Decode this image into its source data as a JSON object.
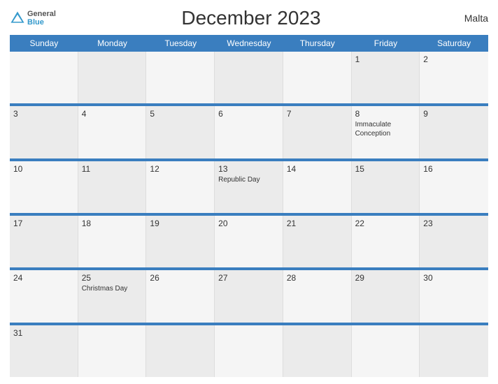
{
  "header": {
    "title": "December 2023",
    "country": "Malta",
    "logo": {
      "general": "General",
      "blue": "Blue"
    }
  },
  "calendar": {
    "days_of_week": [
      "Sunday",
      "Monday",
      "Tuesday",
      "Wednesday",
      "Thursday",
      "Friday",
      "Saturday"
    ],
    "rows": [
      [
        {
          "day": "",
          "holiday": ""
        },
        {
          "day": "",
          "holiday": ""
        },
        {
          "day": "",
          "holiday": ""
        },
        {
          "day": "",
          "holiday": ""
        },
        {
          "day": "",
          "holiday": ""
        },
        {
          "day": "1",
          "holiday": ""
        },
        {
          "day": "2",
          "holiday": ""
        }
      ],
      [
        {
          "day": "3",
          "holiday": ""
        },
        {
          "day": "4",
          "holiday": ""
        },
        {
          "day": "5",
          "holiday": ""
        },
        {
          "day": "6",
          "holiday": ""
        },
        {
          "day": "7",
          "holiday": ""
        },
        {
          "day": "8",
          "holiday": "Immaculate\nConception"
        },
        {
          "day": "9",
          "holiday": ""
        }
      ],
      [
        {
          "day": "10",
          "holiday": ""
        },
        {
          "day": "11",
          "holiday": ""
        },
        {
          "day": "12",
          "holiday": ""
        },
        {
          "day": "13",
          "holiday": "Republic Day"
        },
        {
          "day": "14",
          "holiday": ""
        },
        {
          "day": "15",
          "holiday": ""
        },
        {
          "day": "16",
          "holiday": ""
        }
      ],
      [
        {
          "day": "17",
          "holiday": ""
        },
        {
          "day": "18",
          "holiday": ""
        },
        {
          "day": "19",
          "holiday": ""
        },
        {
          "day": "20",
          "holiday": ""
        },
        {
          "day": "21",
          "holiday": ""
        },
        {
          "day": "22",
          "holiday": ""
        },
        {
          "day": "23",
          "holiday": ""
        }
      ],
      [
        {
          "day": "24",
          "holiday": ""
        },
        {
          "day": "25",
          "holiday": "Christmas Day"
        },
        {
          "day": "26",
          "holiday": ""
        },
        {
          "day": "27",
          "holiday": ""
        },
        {
          "day": "28",
          "holiday": ""
        },
        {
          "day": "29",
          "holiday": ""
        },
        {
          "day": "30",
          "holiday": ""
        }
      ],
      [
        {
          "day": "31",
          "holiday": ""
        },
        {
          "day": "",
          "holiday": ""
        },
        {
          "day": "",
          "holiday": ""
        },
        {
          "day": "",
          "holiday": ""
        },
        {
          "day": "",
          "holiday": ""
        },
        {
          "day": "",
          "holiday": ""
        },
        {
          "day": "",
          "holiday": ""
        }
      ]
    ]
  }
}
